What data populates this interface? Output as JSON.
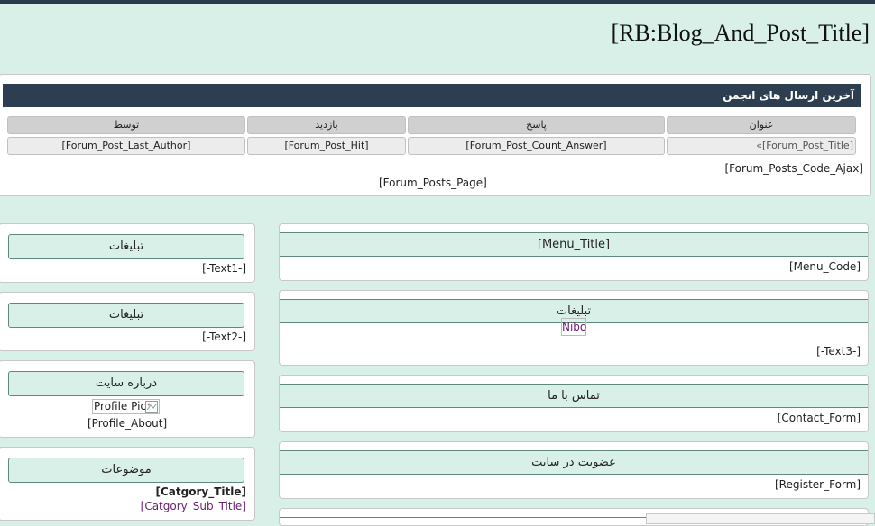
{
  "site": {
    "title": "[RB:Blog_And_Post_Title]"
  },
  "forum": {
    "heading": "آخرین ارسال های انجمن",
    "columns": [
      "عنوان",
      "پاسخ",
      "بازدید",
      "توسط"
    ],
    "row": {
      "title": "«[Forum_Post_Title]",
      "answers": "[Forum_Post_Count_Answer]",
      "hits": "[Forum_Post_Hit]",
      "author": "[Forum_Post_Last_Author]"
    },
    "code_ajax": "[Forum_Posts_Code_Ajax]",
    "page": "[Forum_Posts_Page]"
  },
  "left_panels": {
    "ads1": {
      "title": "تبلیغات",
      "text": "[-Text1-]"
    },
    "ads2": {
      "title": "تبلیغات",
      "text": "[-Text2-]"
    },
    "about": {
      "title": "درباره سایت",
      "pic_alt": "Profile Pic",
      "text": "[Profile_About]"
    },
    "topics": {
      "title": "موضوعات",
      "cat_title": "[Catgory_Title]",
      "cat_sub": "[Catgory_Sub_Title]"
    }
  },
  "right_panels": {
    "menu": {
      "title": "[Menu_Title]",
      "code": "[Menu_Code]"
    },
    "ads3": {
      "title": "تبلیغات",
      "link": "Nibo",
      "text": "[-Text3-]"
    },
    "contact": {
      "title": "تماس با ما",
      "form": "[Contact_Form]"
    },
    "register": {
      "title": "عضویت در سایت",
      "form": "[Register_Form]"
    }
  },
  "icons": {
    "broken_image": "broken-image-icon"
  }
}
